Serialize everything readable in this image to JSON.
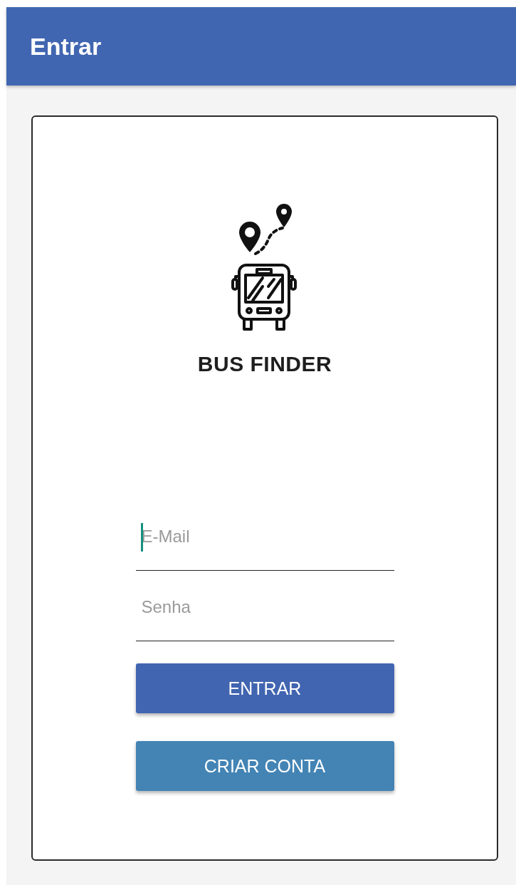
{
  "app_bar": {
    "title": "Entrar"
  },
  "logo": {
    "text": "BUS FINDER"
  },
  "fields": [
    {
      "placeholder": "E-Mail",
      "focused": true
    },
    {
      "placeholder": "Senha",
      "focused": false
    }
  ],
  "buttons": [
    {
      "label": "ENTRAR",
      "kind": "primary"
    },
    {
      "label": "CRIAR CONTA",
      "kind": "secondary"
    }
  ]
}
